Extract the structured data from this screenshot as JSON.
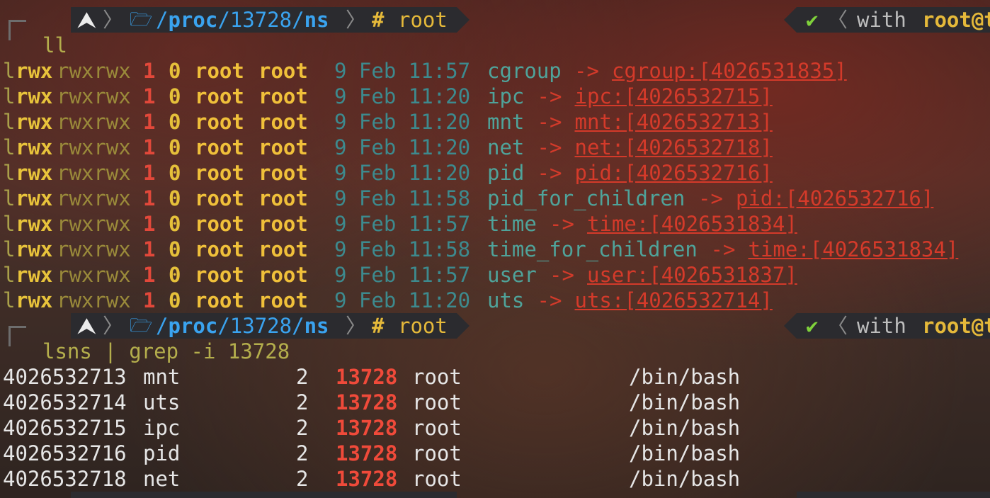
{
  "prompt1": {
    "user_glyph": "⮝",
    "dir_icon": "🗁",
    "path_root": "/",
    "path_a": "proc",
    "path_sep1": "/",
    "path_b": "13728",
    "path_sep2": "/",
    "path_c": "ns",
    "hash": "#",
    "user": "root",
    "check": "✔",
    "with": "with",
    "right_user": "root@t"
  },
  "command1": "ll",
  "ls_rows": [
    {
      "perm_l": "l",
      "perm_rwx": "rwx",
      "perm_rest": "rwxrwx",
      "links": "1",
      "size": "0",
      "owner": "root",
      "group": "root",
      "date": "9 Feb 11:57",
      "name": "cgroup",
      "arrow": "->",
      "target": "cgroup:[4026531835]"
    },
    {
      "perm_l": "l",
      "perm_rwx": "rwx",
      "perm_rest": "rwxrwx",
      "links": "1",
      "size": "0",
      "owner": "root",
      "group": "root",
      "date": "9 Feb 11:20",
      "name": "ipc",
      "arrow": "->",
      "target": "ipc:[4026532715]"
    },
    {
      "perm_l": "l",
      "perm_rwx": "rwx",
      "perm_rest": "rwxrwx",
      "links": "1",
      "size": "0",
      "owner": "root",
      "group": "root",
      "date": "9 Feb 11:20",
      "name": "mnt",
      "arrow": "->",
      "target": "mnt:[4026532713]"
    },
    {
      "perm_l": "l",
      "perm_rwx": "rwx",
      "perm_rest": "rwxrwx",
      "links": "1",
      "size": "0",
      "owner": "root",
      "group": "root",
      "date": "9 Feb 11:20",
      "name": "net",
      "arrow": "->",
      "target": "net:[4026532718]"
    },
    {
      "perm_l": "l",
      "perm_rwx": "rwx",
      "perm_rest": "rwxrwx",
      "links": "1",
      "size": "0",
      "owner": "root",
      "group": "root",
      "date": "9 Feb 11:20",
      "name": "pid",
      "arrow": "->",
      "target": "pid:[4026532716]"
    },
    {
      "perm_l": "l",
      "perm_rwx": "rwx",
      "perm_rest": "rwxrwx",
      "links": "1",
      "size": "0",
      "owner": "root",
      "group": "root",
      "date": "9 Feb 11:58",
      "name": "pid_for_children",
      "arrow": "->",
      "target": "pid:[4026532716]"
    },
    {
      "perm_l": "l",
      "perm_rwx": "rwx",
      "perm_rest": "rwxrwx",
      "links": "1",
      "size": "0",
      "owner": "root",
      "group": "root",
      "date": "9 Feb 11:57",
      "name": "time",
      "arrow": "->",
      "target": "time:[4026531834]"
    },
    {
      "perm_l": "l",
      "perm_rwx": "rwx",
      "perm_rest": "rwxrwx",
      "links": "1",
      "size": "0",
      "owner": "root",
      "group": "root",
      "date": "9 Feb 11:58",
      "name": "time_for_children",
      "arrow": "->",
      "target": "time:[4026531834]"
    },
    {
      "perm_l": "l",
      "perm_rwx": "rwx",
      "perm_rest": "rwxrwx",
      "links": "1",
      "size": "0",
      "owner": "root",
      "group": "root",
      "date": "9 Feb 11:57",
      "name": "user",
      "arrow": "->",
      "target": "user:[4026531837]"
    },
    {
      "perm_l": "l",
      "perm_rwx": "rwx",
      "perm_rest": "rwxrwx",
      "links": "1",
      "size": "0",
      "owner": "root",
      "group": "root",
      "date": "9 Feb 11:20",
      "name": "uts",
      "arrow": "->",
      "target": "uts:[4026532714]"
    }
  ],
  "prompt2": {
    "user_glyph": "⮝",
    "dir_icon": "🗁",
    "path_root": "/",
    "path_a": "proc",
    "path_sep1": "/",
    "path_b": "13728",
    "path_sep2": "/",
    "path_c": "ns",
    "hash": "#",
    "user": "root",
    "check": "✔",
    "with": "with",
    "right_user": "root@t"
  },
  "command2": "lsns | grep -i 13728",
  "lsns_rows": [
    {
      "ns": "4026532713",
      "type": "mnt",
      "nprocs": "2",
      "pid": "13728",
      "user": "root",
      "command": "/bin/bash"
    },
    {
      "ns": "4026532714",
      "type": "uts",
      "nprocs": "2",
      "pid": "13728",
      "user": "root",
      "command": "/bin/bash"
    },
    {
      "ns": "4026532715",
      "type": "ipc",
      "nprocs": "2",
      "pid": "13728",
      "user": "root",
      "command": "/bin/bash"
    },
    {
      "ns": "4026532716",
      "type": "pid",
      "nprocs": "2",
      "pid": "13728",
      "user": "root",
      "command": "/bin/bash"
    },
    {
      "ns": "4026532718",
      "type": "net",
      "nprocs": "2",
      "pid": "13728",
      "user": "root",
      "command": "/bin/bash"
    }
  ]
}
